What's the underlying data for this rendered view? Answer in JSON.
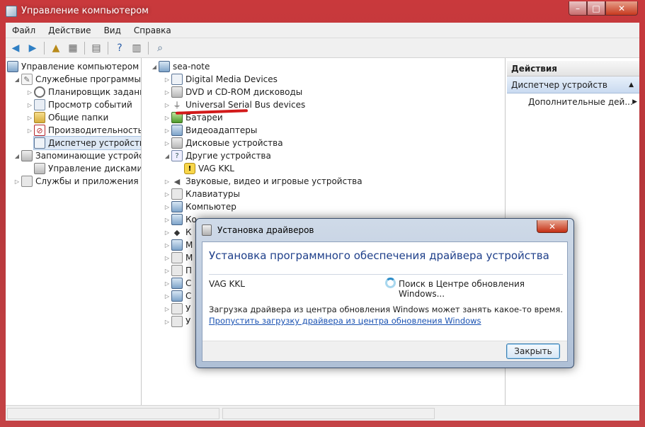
{
  "window": {
    "title": "Управление компьютером",
    "controls": {
      "minimize": "–",
      "maximize": "□",
      "close": "✕"
    }
  },
  "menu": [
    "Файл",
    "Действие",
    "Вид",
    "Справка"
  ],
  "left_tree": [
    {
      "label": "Управление компьютером (л",
      "icon": "computer-icon",
      "arrow": ""
    },
    {
      "label": "Служебные программы",
      "icon": "tools-icon",
      "arrow": "◢"
    },
    {
      "label": "Планировщик заданий",
      "icon": "clock-icon",
      "arrow": "▷"
    },
    {
      "label": "Просмотр событий",
      "icon": "event-log-icon",
      "arrow": "▷"
    },
    {
      "label": "Общие папки",
      "icon": "shared-folder-icon",
      "arrow": "▷"
    },
    {
      "label": "Производительность",
      "icon": "performance-icon",
      "arrow": "▷"
    },
    {
      "label": "Диспетчер устройств",
      "icon": "device-manager-icon",
      "arrow": ""
    },
    {
      "label": "Запоминающие устройст",
      "icon": "storage-icon",
      "arrow": "◢"
    },
    {
      "label": "Управление дисками",
      "icon": "disk-management-icon",
      "arrow": ""
    },
    {
      "label": "Службы и приложения",
      "icon": "services-icon",
      "arrow": "▷"
    }
  ],
  "device_tree": {
    "root": "sea-note",
    "items": [
      {
        "label": "Digital Media Devices",
        "arrow": "▷"
      },
      {
        "label": "DVD и CD-ROM дисководы",
        "arrow": "▷"
      },
      {
        "label": "Universal Serial Bus devices",
        "arrow": "▷"
      },
      {
        "label": "Батареи",
        "arrow": "▷"
      },
      {
        "label": "Видеоадаптеры",
        "arrow": "▷"
      },
      {
        "label": "Дисковые устройства",
        "arrow": "▷"
      },
      {
        "label": "Другие устройства",
        "arrow": "◢"
      },
      {
        "label": "VAG KKL",
        "arrow": ""
      },
      {
        "label": "Звуковые, видео и игровые устройства",
        "arrow": "▷"
      },
      {
        "label": "Клавиатуры",
        "arrow": "▷"
      },
      {
        "label": "Компьютер",
        "arrow": "▷"
      },
      {
        "label": "Ко",
        "arrow": "▷"
      },
      {
        "label": "К",
        "arrow": "▷"
      },
      {
        "label": "М",
        "arrow": "▷"
      },
      {
        "label": "М",
        "arrow": "▷"
      },
      {
        "label": "П",
        "arrow": "▷"
      },
      {
        "label": "С",
        "arrow": "▷"
      },
      {
        "label": "С",
        "arrow": "▷"
      },
      {
        "label": "У",
        "arrow": "▷"
      },
      {
        "label": "У",
        "arrow": "▷"
      }
    ]
  },
  "actions": {
    "header": "Действия",
    "section": "Диспетчер устройств",
    "more": "Дополнительные дей..."
  },
  "dialog": {
    "title": "Установка драйверов",
    "heading": "Установка программного обеспечения драйвера устройства",
    "device": "VAG KKL",
    "status": "Поиск в Центре обновления Windows...",
    "info": "Загрузка драйвера из центра обновления Windows может занять какое-то время.",
    "skip_link": "Пропустить загрузку драйвера из центра обновления Windows",
    "close_button": "Закрыть",
    "close_x": "✕"
  },
  "colors": {
    "accent": "#1e3f8a",
    "link": "#1a52b2",
    "highlight": "#d21a1a"
  }
}
